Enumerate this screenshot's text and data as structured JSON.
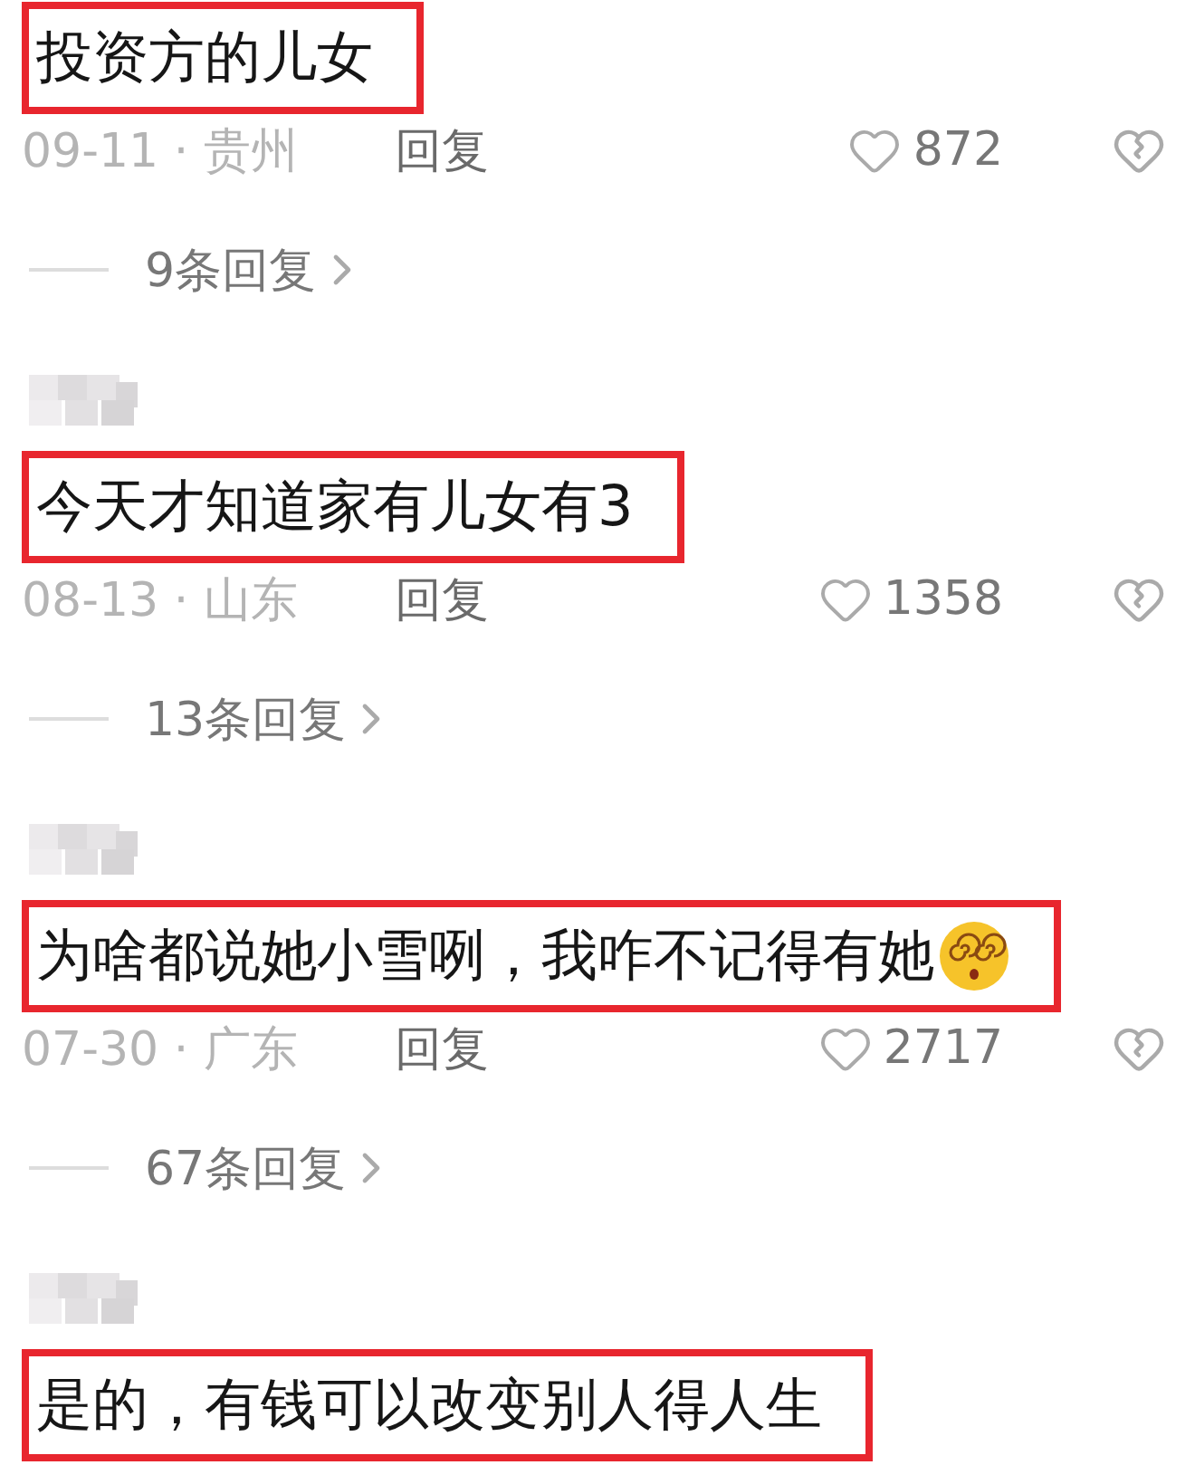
{
  "comments": [
    {
      "username_blurred": false,
      "highlighted": true,
      "text": "投资方的儿女",
      "emoji": false,
      "meta": {
        "date": "09-11",
        "separator": "·",
        "region": "贵州",
        "reply": "回复",
        "likes": "872"
      },
      "replies": "9条回复"
    },
    {
      "username_blurred": true,
      "highlighted": true,
      "text": "今天才知道家有儿女有3",
      "emoji": false,
      "meta": {
        "date": "08-13",
        "separator": "·",
        "region": "山东",
        "reply": "回复",
        "likes": "1358"
      },
      "replies": "13条回复"
    },
    {
      "username_blurred": true,
      "highlighted": true,
      "text": "为啥都说她小雪咧，我咋不记得有她",
      "emoji": true,
      "meta": {
        "date": "07-30",
        "separator": "·",
        "region": "广东",
        "reply": "回复",
        "likes": "2717"
      },
      "replies": "67条回复"
    },
    {
      "username_blurred": true,
      "highlighted": true,
      "text": "是的，有钱可以改变别人得人生",
      "emoji": false
    }
  ]
}
